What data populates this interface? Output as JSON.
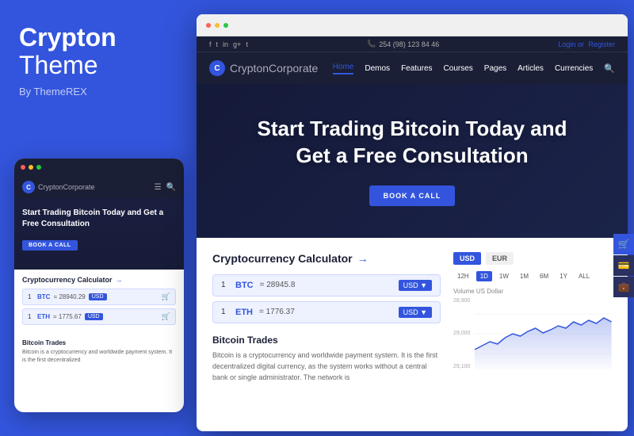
{
  "brand": {
    "title": "Crypton",
    "subtitle": "Theme",
    "by": "By ThemeREX"
  },
  "mobile": {
    "logo": "Crypton",
    "logo_sub": "Corporate",
    "hero_title": "Start Trading Bitcoin Today and Get a Free Consultation",
    "cta_btn": "BOOK A CALL",
    "calc_title": "Cryptocurrency Calculator",
    "calc_rows": [
      {
        "num": "1",
        "coin": "BTC",
        "eq": "= 28940.29",
        "currency": "USD"
      },
      {
        "num": "1",
        "coin": "ETH",
        "eq": "= 1775.67",
        "currency": "USD"
      }
    ],
    "bitcoin_title": "Bitcoin Trades",
    "bitcoin_text": "Bitcoin is a cryptocurrency and worldwide payment system. It is the first decentralized"
  },
  "browser": {
    "social_icons": [
      "f",
      "t",
      "in",
      "g+",
      "t"
    ],
    "contact": "254 (98) 123 84 46",
    "login_text": "Login or",
    "register_text": "Register",
    "logo": "Crypton",
    "logo_sub": "Corporate",
    "nav_links": [
      "Home",
      "Demos",
      "Features",
      "Courses",
      "Pages",
      "Articles",
      "Currencies"
    ],
    "hero_title": "Start Trading Bitcoin Today and\nGet a Free Consultation",
    "hero_btn": "BOOK A CALL",
    "calc_title": "Cryptocurrency Calculator",
    "calc_rows": [
      {
        "num": "1",
        "coin": "BTC",
        "val": "= 28945.8",
        "currency": "USD"
      },
      {
        "num": "1",
        "coin": "ETH",
        "val": "= 1776.37",
        "currency": "USD"
      }
    ],
    "currency_tabs": [
      "USD",
      "EUR"
    ],
    "time_tabs": [
      "12H",
      "1D",
      "1W",
      "1M",
      "6M",
      "1Y",
      "ALL"
    ],
    "active_time_tab": "1D",
    "chart_label": "Volume US Dollar",
    "chart_y_labels": [
      "29,100",
      "29,000",
      "28,900"
    ],
    "bitcoin_title": "Bitcoin Trades",
    "bitcoin_text": "Bitcoin is a cryptocurrency and worldwide payment system. It is the first decentralized digital currency, as the system works without a central bank or single administrator. The network is"
  },
  "icons": {
    "dots": "•••",
    "cart": "🛒",
    "phone": "📞",
    "search": "🔍",
    "menu": "☰",
    "arrow_right": "→"
  }
}
